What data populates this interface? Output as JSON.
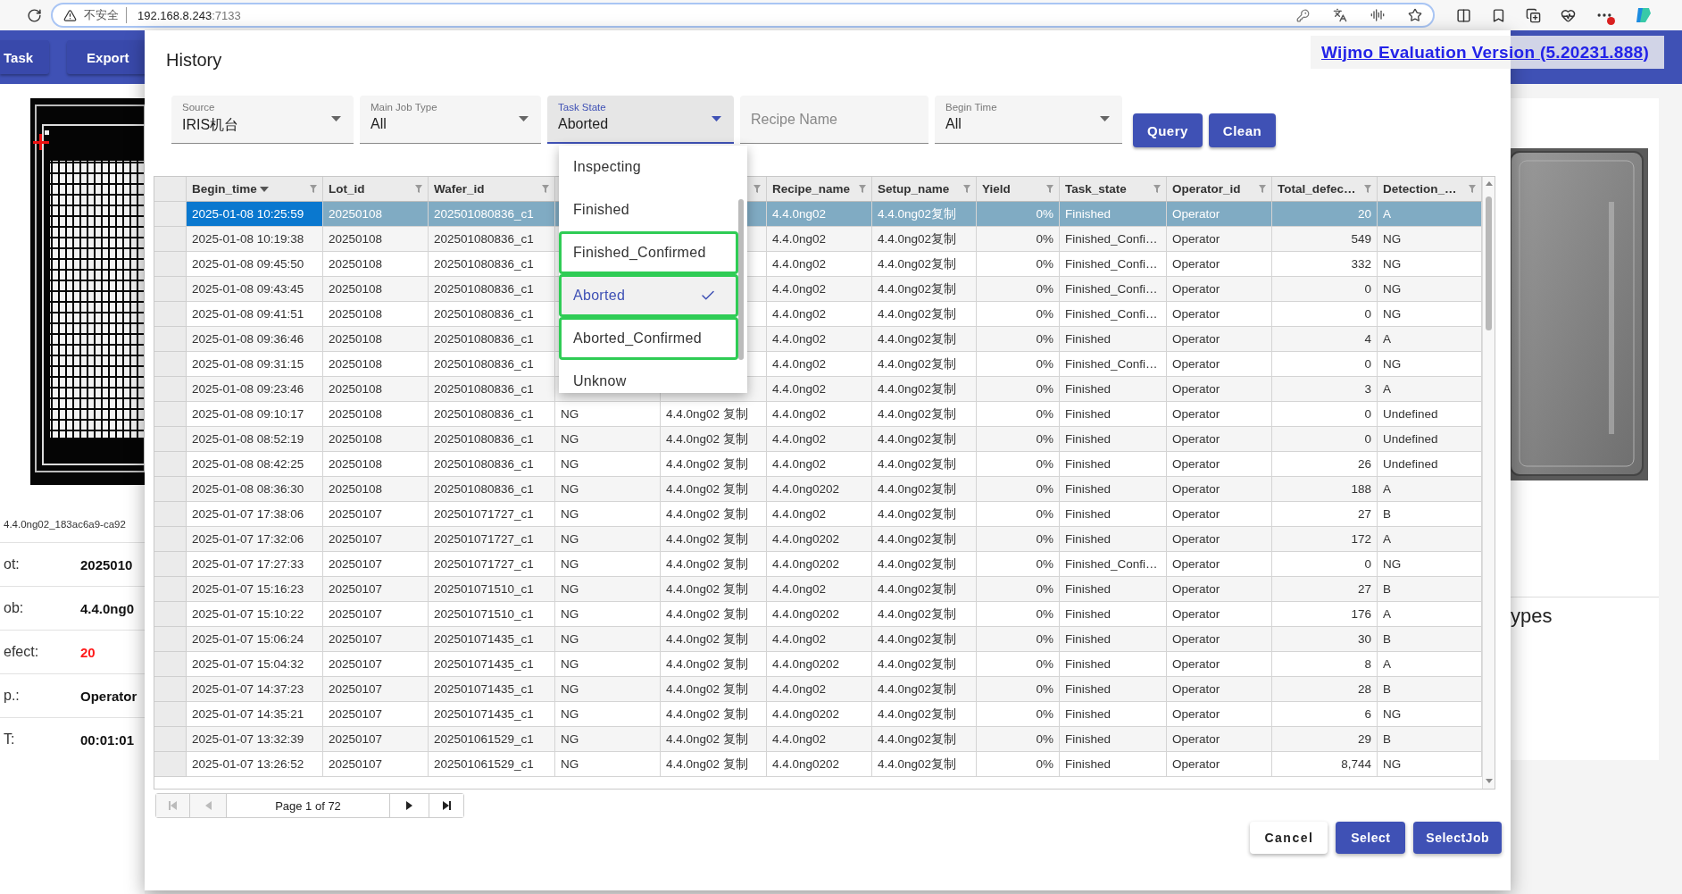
{
  "browser": {
    "security": "不安全",
    "host": "192.168.8.243",
    "port": ":7133"
  },
  "app": {
    "buttons": [
      "Task",
      "Export"
    ],
    "left_panel": {
      "file": "4.4.0ng02_183ac6a9-ca92",
      "fields": [
        {
          "label": "ot:",
          "value": "2025010",
          "alert": false
        },
        {
          "label": "ob:",
          "value": "4.4.0ng0",
          "alert": false
        },
        {
          "label": "efect:",
          "value": "20",
          "alert": true
        },
        {
          "label": "p.:",
          "value": "Operator",
          "alert": false
        },
        {
          "label": "T:",
          "value": "00:01:01",
          "alert": false
        }
      ]
    },
    "right_panel": {
      "heading": "ypes"
    }
  },
  "wijmo_notice": "Wijmo Evaluation Version (5.20231.888)",
  "dialog": {
    "title": "History",
    "filters": [
      {
        "kind": "select",
        "label": "Source",
        "value": "IRIS机台",
        "open": false
      },
      {
        "kind": "select",
        "label": "Main Job Type",
        "value": "All",
        "open": false
      },
      {
        "kind": "select",
        "label": "Task State",
        "value": "Aborted",
        "open": true
      },
      {
        "kind": "text",
        "placeholder": "Recipe Name"
      },
      {
        "kind": "select",
        "label": "Begin Time",
        "value": "All",
        "open": false
      }
    ],
    "actions": [
      "Query",
      "Clean"
    ],
    "dropdown": {
      "options": [
        {
          "label": "Inspecting",
          "selected": false,
          "outlined": false
        },
        {
          "label": "Finished",
          "selected": false,
          "outlined": false
        },
        {
          "label": "Finished_Confirmed",
          "selected": false,
          "outlined": true
        },
        {
          "label": "Aborted",
          "selected": true,
          "outlined": true
        },
        {
          "label": "Aborted_Confirmed",
          "selected": false,
          "outlined": true
        },
        {
          "label": "Unknow",
          "selected": false,
          "outlined": false
        }
      ]
    },
    "table": {
      "columns": [
        {
          "label": "Begin_time",
          "sorted": true
        },
        {
          "label": "Lot_id",
          "sorted": false
        },
        {
          "label": "Wafer_id",
          "sorted": false
        },
        {},
        {
          "filter": true
        },
        {
          "label": "Recipe_name",
          "sorted": false
        },
        {
          "label": "Setup_name",
          "sorted": false
        },
        {
          "label": "Yield",
          "sorted": false
        },
        {
          "label": "Task_state",
          "sorted": false
        },
        {
          "label": "Operator_id",
          "sorted": false
        },
        {
          "label": "Total_defec…",
          "sorted": false
        },
        {
          "label": "Detection_…",
          "sorted": false
        }
      ],
      "rows": [
        {
          "selected": true,
          "cells": [
            "2025-01-08 10:25:59",
            "20250108",
            "202501080836_c1",
            null,
            null,
            "4.4.0ng02",
            "4.4.0ng02复制",
            "0%",
            "Finished",
            "Operator",
            "20",
            "A"
          ]
        },
        {
          "selected": false,
          "cells": [
            "2025-01-08 10:19:38",
            "20250108",
            "202501080836_c1",
            null,
            null,
            "4.4.0ng02",
            "4.4.0ng02复制",
            "0%",
            "Finished_Confi…",
            "Operator",
            "549",
            "NG"
          ]
        },
        {
          "selected": false,
          "cells": [
            "2025-01-08 09:45:50",
            "20250108",
            "202501080836_c1",
            null,
            null,
            "4.4.0ng02",
            "4.4.0ng02复制",
            "0%",
            "Finished_Confi…",
            "Operator",
            "332",
            "NG"
          ]
        },
        {
          "selected": false,
          "cells": [
            "2025-01-08 09:43:45",
            "20250108",
            "202501080836_c1",
            null,
            null,
            "4.4.0ng02",
            "4.4.0ng02复制",
            "0%",
            "Finished_Confi…",
            "Operator",
            "0",
            "NG"
          ]
        },
        {
          "selected": false,
          "cells": [
            "2025-01-08 09:41:51",
            "20250108",
            "202501080836_c1",
            null,
            null,
            "4.4.0ng02",
            "4.4.0ng02复制",
            "0%",
            "Finished_Confi…",
            "Operator",
            "0",
            "NG"
          ]
        },
        {
          "selected": false,
          "cells": [
            "2025-01-08 09:36:46",
            "20250108",
            "202501080836_c1",
            null,
            null,
            "4.4.0ng02",
            "4.4.0ng02复制",
            "0%",
            "Finished",
            "Operator",
            "4",
            "A"
          ]
        },
        {
          "selected": false,
          "cells": [
            "2025-01-08 09:31:15",
            "20250108",
            "202501080836_c1",
            null,
            null,
            "4.4.0ng02",
            "4.4.0ng02复制",
            "0%",
            "Finished_Confi…",
            "Operator",
            "0",
            "NG"
          ]
        },
        {
          "selected": false,
          "cells": [
            "2025-01-08 09:23:46",
            "20250108",
            "202501080836_c1",
            null,
            null,
            "4.4.0ng02",
            "4.4.0ng02复制",
            "0%",
            "Finished",
            "Operator",
            "3",
            "A"
          ]
        },
        {
          "selected": false,
          "cells": [
            "2025-01-08 09:10:17",
            "20250108",
            "202501080836_c1",
            "NG",
            "4.4.0ng02 复制",
            "4.4.0ng02",
            "4.4.0ng02复制",
            "0%",
            "Finished",
            "Operator",
            "0",
            "Undefined"
          ]
        },
        {
          "selected": false,
          "cells": [
            "2025-01-08 08:52:19",
            "20250108",
            "202501080836_c1",
            "NG",
            "4.4.0ng02 复制",
            "4.4.0ng02",
            "4.4.0ng02复制",
            "0%",
            "Finished",
            "Operator",
            "0",
            "Undefined"
          ]
        },
        {
          "selected": false,
          "cells": [
            "2025-01-08 08:42:25",
            "20250108",
            "202501080836_c1",
            "NG",
            "4.4.0ng02 复制",
            "4.4.0ng02",
            "4.4.0ng02复制",
            "0%",
            "Finished",
            "Operator",
            "26",
            "Undefined"
          ]
        },
        {
          "selected": false,
          "cells": [
            "2025-01-08 08:36:30",
            "20250108",
            "202501080836_c1",
            "NG",
            "4.4.0ng02 复制",
            "4.4.0ng0202",
            "4.4.0ng02复制",
            "0%",
            "Finished",
            "Operator",
            "188",
            "A"
          ]
        },
        {
          "selected": false,
          "cells": [
            "2025-01-07 17:38:06",
            "20250107",
            "202501071727_c1",
            "NG",
            "4.4.0ng02 复制",
            "4.4.0ng02",
            "4.4.0ng02复制",
            "0%",
            "Finished",
            "Operator",
            "27",
            "B"
          ]
        },
        {
          "selected": false,
          "cells": [
            "2025-01-07 17:32:06",
            "20250107",
            "202501071727_c1",
            "NG",
            "4.4.0ng02 复制",
            "4.4.0ng0202",
            "4.4.0ng02复制",
            "0%",
            "Finished",
            "Operator",
            "172",
            "A"
          ]
        },
        {
          "selected": false,
          "cells": [
            "2025-01-07 17:27:33",
            "20250107",
            "202501071727_c1",
            "NG",
            "4.4.0ng02 复制",
            "4.4.0ng0202",
            "4.4.0ng02复制",
            "0%",
            "Finished_Confi…",
            "Operator",
            "0",
            "NG"
          ]
        },
        {
          "selected": false,
          "cells": [
            "2025-01-07 15:16:23",
            "20250107",
            "202501071510_c1",
            "NG",
            "4.4.0ng02 复制",
            "4.4.0ng02",
            "4.4.0ng02复制",
            "0%",
            "Finished",
            "Operator",
            "27",
            "B"
          ]
        },
        {
          "selected": false,
          "cells": [
            "2025-01-07 15:10:22",
            "20250107",
            "202501071510_c1",
            "NG",
            "4.4.0ng02 复制",
            "4.4.0ng0202",
            "4.4.0ng02复制",
            "0%",
            "Finished",
            "Operator",
            "176",
            "A"
          ]
        },
        {
          "selected": false,
          "cells": [
            "2025-01-07 15:06:24",
            "20250107",
            "202501071435_c1",
            "NG",
            "4.4.0ng02 复制",
            "4.4.0ng02",
            "4.4.0ng02复制",
            "0%",
            "Finished",
            "Operator",
            "30",
            "B"
          ]
        },
        {
          "selected": false,
          "cells": [
            "2025-01-07 15:04:32",
            "20250107",
            "202501071435_c1",
            "NG",
            "4.4.0ng02 复制",
            "4.4.0ng0202",
            "4.4.0ng02复制",
            "0%",
            "Finished",
            "Operator",
            "8",
            "A"
          ]
        },
        {
          "selected": false,
          "cells": [
            "2025-01-07 14:37:23",
            "20250107",
            "202501071435_c1",
            "NG",
            "4.4.0ng02 复制",
            "4.4.0ng02",
            "4.4.0ng02复制",
            "0%",
            "Finished",
            "Operator",
            "28",
            "B"
          ]
        },
        {
          "selected": false,
          "cells": [
            "2025-01-07 14:35:21",
            "20250107",
            "202501071435_c1",
            "NG",
            "4.4.0ng02 复制",
            "4.4.0ng0202",
            "4.4.0ng02复制",
            "0%",
            "Finished",
            "Operator",
            "6",
            "NG"
          ]
        },
        {
          "selected": false,
          "cells": [
            "2025-01-07 13:32:39",
            "20250107",
            "202501061529_c1",
            "NG",
            "4.4.0ng02 复制",
            "4.4.0ng02",
            "4.4.0ng02复制",
            "0%",
            "Finished",
            "Operator",
            "29",
            "B"
          ]
        },
        {
          "selected": false,
          "cells": [
            "2025-01-07 13:26:52",
            "20250107",
            "202501061529_c1",
            "NG",
            "4.4.0ng02 复制",
            "4.4.0ng0202",
            "4.4.0ng02复制",
            "0%",
            "Finished",
            "Operator",
            "8,744",
            "NG"
          ]
        }
      ]
    },
    "pager": {
      "label": "Page 1 of 72",
      "buttons": [
        {
          "kind": "first",
          "disabled": true
        },
        {
          "kind": "prev",
          "disabled": true
        },
        {
          "kind": "next",
          "disabled": false
        },
        {
          "kind": "last",
          "disabled": false
        }
      ]
    },
    "footer_buttons": [
      {
        "label": "Cancel",
        "kind": "outlined"
      },
      {
        "label": "Select",
        "kind": "filled"
      },
      {
        "label": "SelectJob",
        "kind": "filled"
      }
    ]
  }
}
